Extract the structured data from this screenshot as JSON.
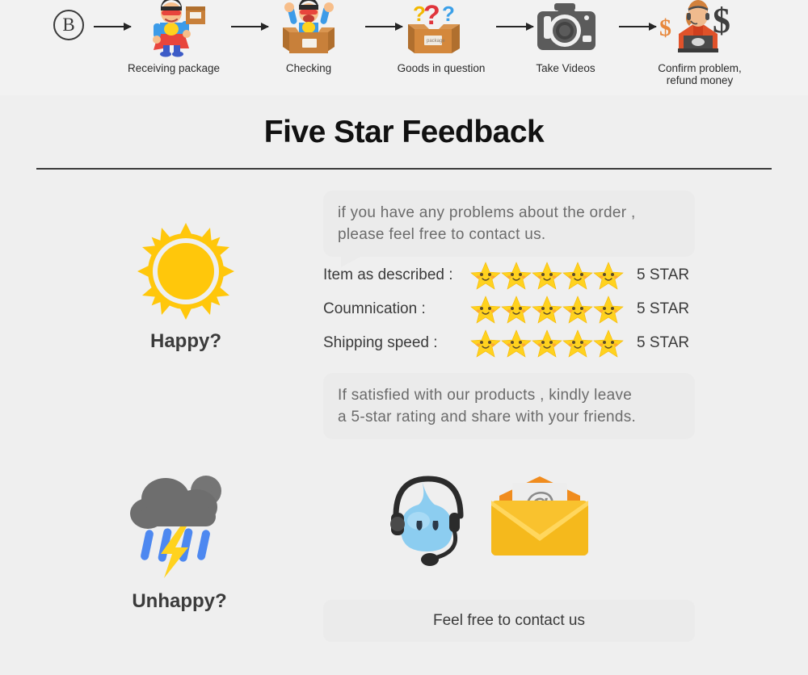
{
  "page": {
    "background_color": "#efefef",
    "title": "Five Star Feedback"
  },
  "process_flow": {
    "badge_label": "B",
    "steps": [
      {
        "label": "Receiving package",
        "icon": "superhero-with-package-icon"
      },
      {
        "label": "Checking",
        "icon": "person-in-open-box-icon"
      },
      {
        "label": "Goods in question",
        "icon": "box-with-question-marks-icon"
      },
      {
        "label": "Take Videos",
        "icon": "camera-icon"
      },
      {
        "label": "Confirm problem,\nrefund money",
        "icon": "support-agent-with-dollar-icon"
      }
    ],
    "arrow_icon": "right-arrow-icon"
  },
  "happy": {
    "mood_label": "Happy?",
    "mood_icon": "sun-icon",
    "bubble_top": "if you have any problems about the order ,\nplease feel free to contact us.",
    "bubble_bottom": "If satisfied with our products ,  kindly leave\na 5-star rating and share with your friends.",
    "ratings": [
      {
        "label": "Item as described :",
        "stars": 5,
        "value": "5 STAR"
      },
      {
        "label": "Coumnication :",
        "stars": 5,
        "value": "5 STAR"
      },
      {
        "label": "Shipping speed :",
        "stars": 5,
        "value": "5 STAR"
      }
    ]
  },
  "unhappy": {
    "mood_label": "Unhappy?",
    "mood_icon": "rain-cloud-with-lightning-icon",
    "support_icons": [
      {
        "name": "headset-mascot-icon"
      },
      {
        "name": "email-envelope-icon"
      }
    ],
    "contact_label": "Feel free to contact us"
  },
  "colors": {
    "sun_yellow": "#FFC70B",
    "star_yellow": "#FFD21E",
    "cloud_gray": "#6E6E6E",
    "rain_blue": "#4D88F0",
    "lightning_yellow": "#FFD21E",
    "envelope_yellow": "#F9C22E",
    "mascot_blue": "#7CC8F0",
    "camera_gray": "#5B5B5B",
    "text_dark": "#3a3a3a",
    "bubble_gray": "#ebebeb",
    "bubble_text": "#6b6b6b"
  }
}
